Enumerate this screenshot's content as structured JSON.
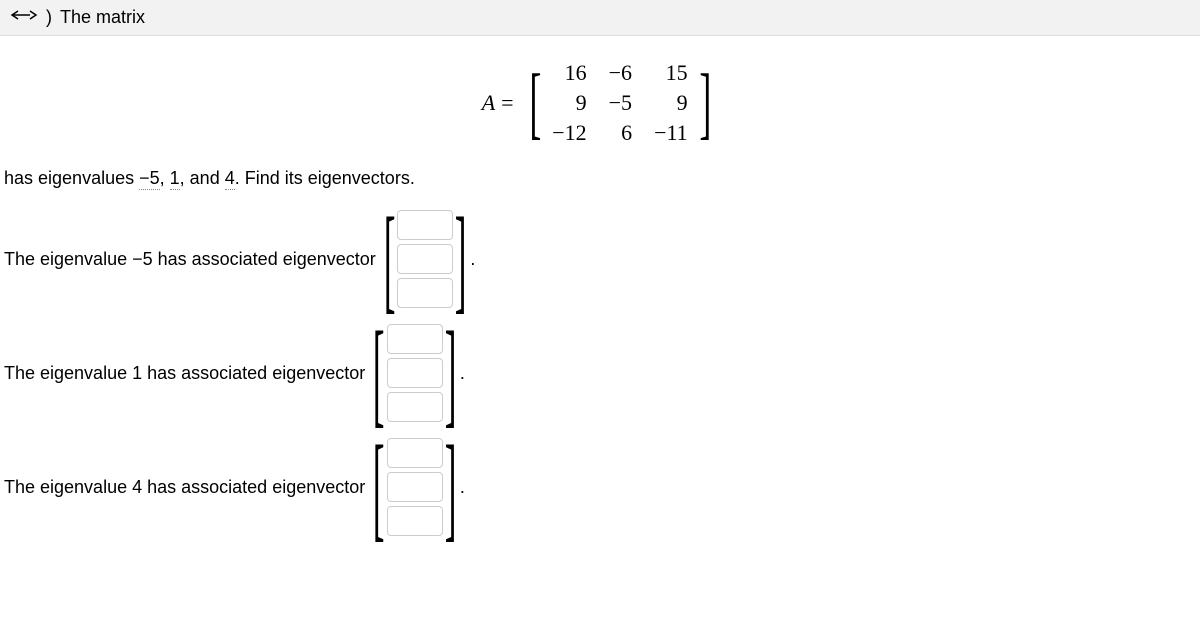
{
  "header": {
    "intro_text": "The matrix"
  },
  "matrix": {
    "lhs": "A",
    "eq": "=",
    "rows": [
      [
        "16",
        "−6",
        "15"
      ],
      [
        "9",
        "−5",
        "9"
      ],
      [
        "−12",
        "6",
        "−11"
      ]
    ]
  },
  "sentence": {
    "prefix": "has eigenvalues ",
    "ev1": "−5",
    "sep1": ", ",
    "ev2": "1",
    "sep2": ", and ",
    "ev3": "4",
    "suffix": ". Find its eigenvectors."
  },
  "eigenvectors": [
    {
      "prefix": "The eigenvalue ",
      "value": "−5",
      "suffix": " has associated eigenvector"
    },
    {
      "prefix": "The eigenvalue ",
      "value": "1",
      "suffix": " has associated eigenvector"
    },
    {
      "prefix": "The eigenvalue ",
      "value": "4",
      "suffix": " has associated eigenvector"
    }
  ],
  "period": "."
}
